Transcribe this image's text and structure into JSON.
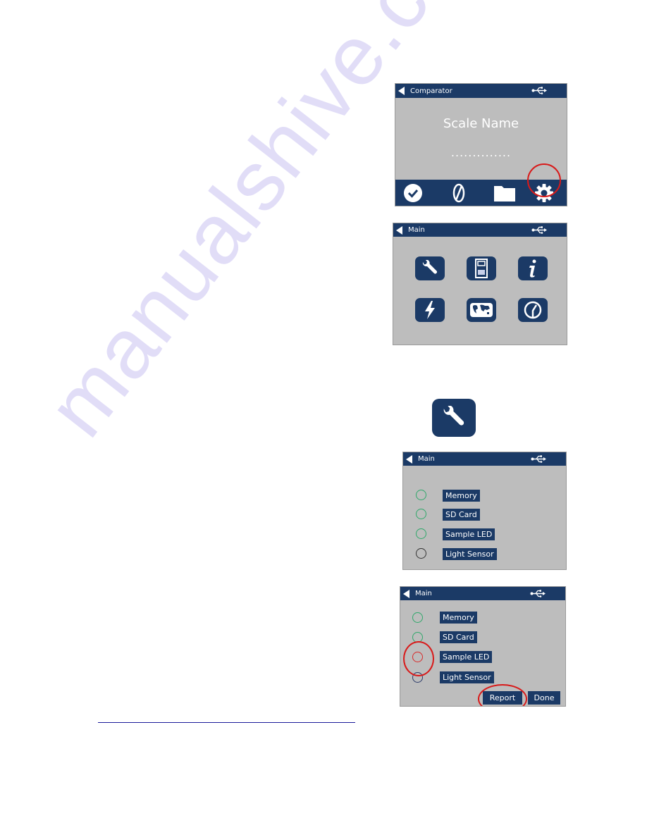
{
  "watermark": "manualshive.com",
  "colors": {
    "bar": "#1b3a66",
    "screen_bg": "#bdbdbd",
    "ok_circle": "#2fa86a",
    "fail_circle": "#d82a2a",
    "pending_circle": "#2a3a6a",
    "idle_circle": "#333333",
    "highlight_ring": "#d81a1a",
    "link": "#1a1a9a"
  },
  "screens": [
    {
      "title": "Comparator",
      "center_title": "Scale Name",
      "center_value": "..............",
      "bottom_icons": [
        "check-icon",
        "zero-icon",
        "folder-icon",
        "gear-icon"
      ],
      "highlighted": "gear-icon"
    },
    {
      "title": "Main",
      "tiles": [
        "wrench-icon",
        "device-icon",
        "info-icon",
        "lightning-icon",
        "world-map-icon",
        "clock-icon"
      ]
    },
    {
      "standalone_icon": "wrench-icon"
    },
    {
      "title": "Main",
      "tests": [
        {
          "label": "Memory",
          "status": "ok"
        },
        {
          "label": "SD Card",
          "status": "ok"
        },
        {
          "label": "Sample LED",
          "status": "ok"
        },
        {
          "label": "Light Sensor",
          "status": "idle"
        }
      ]
    },
    {
      "title": "Main",
      "tests": [
        {
          "label": "Memory",
          "status": "ok"
        },
        {
          "label": "SD Card",
          "status": "ok"
        },
        {
          "label": "Sample LED",
          "status": "fail"
        },
        {
          "label": "Light Sensor",
          "status": "pending"
        }
      ],
      "buttons": {
        "report": "Report",
        "done": "Done"
      },
      "highlighted": [
        "Sample LED status",
        "Report"
      ]
    }
  ]
}
